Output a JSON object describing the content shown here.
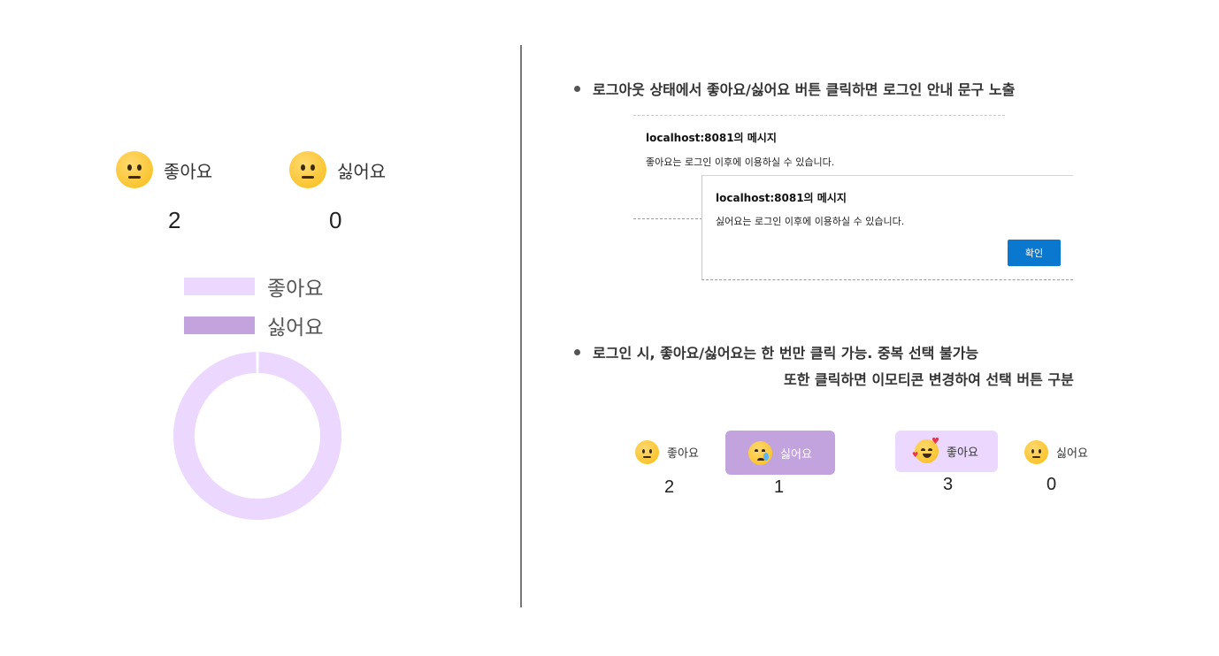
{
  "left": {
    "like": {
      "icon": "neutral-face-icon",
      "label": "좋아요",
      "count": "2"
    },
    "dislike": {
      "icon": "neutral-face-icon",
      "label": "싫어요",
      "count": "0"
    },
    "legend": [
      {
        "label": "좋아요",
        "color": "#ecd8ff"
      },
      {
        "label": "싫어요",
        "color": "#c3a3dd"
      }
    ],
    "donut": {
      "type": "pie",
      "categories": [
        "좋아요",
        "싫어요"
      ],
      "values": [
        2,
        0
      ],
      "colors": [
        "#ecd8ff",
        "#c3a3dd"
      ]
    }
  },
  "right": {
    "note1": "로그아웃 상태에서 좋아요/싫어요 버튼 클릭하면 로그인 안내 문구 노출",
    "dialog1": {
      "title": "localhost:8081의 메시지",
      "message": "좋아요는 로그인 이후에 이용하실 수 있습니다."
    },
    "dialog2": {
      "title": "localhost:8081의 메시지",
      "message": "싫어요는 로그인 이후에 이용하실 수 있습니다.",
      "ok": "확인"
    },
    "note2": "로그인 시, 좋아요/싫어요는 한 번만 클릭 가능. 중복 선택 불가능",
    "note2_line2": "또한 클릭하면 이모티콘 변경하여 선택 버튼 구분",
    "example1": {
      "like": {
        "icon": "neutral-face-icon",
        "label": "좋아요",
        "count": "2",
        "selected": false
      },
      "dislike": {
        "icon": "crying-face-icon",
        "label": "싫어요",
        "count": "1",
        "selected": true,
        "bg": "#c3a3dd"
      }
    },
    "example2": {
      "like": {
        "icon": "smiling-face-with-hearts-icon",
        "label": "좋아요",
        "count": "3",
        "selected": true,
        "bg": "#ecd8ff"
      },
      "dislike": {
        "icon": "neutral-face-icon",
        "label": "싫어요",
        "count": "0",
        "selected": false
      }
    }
  }
}
